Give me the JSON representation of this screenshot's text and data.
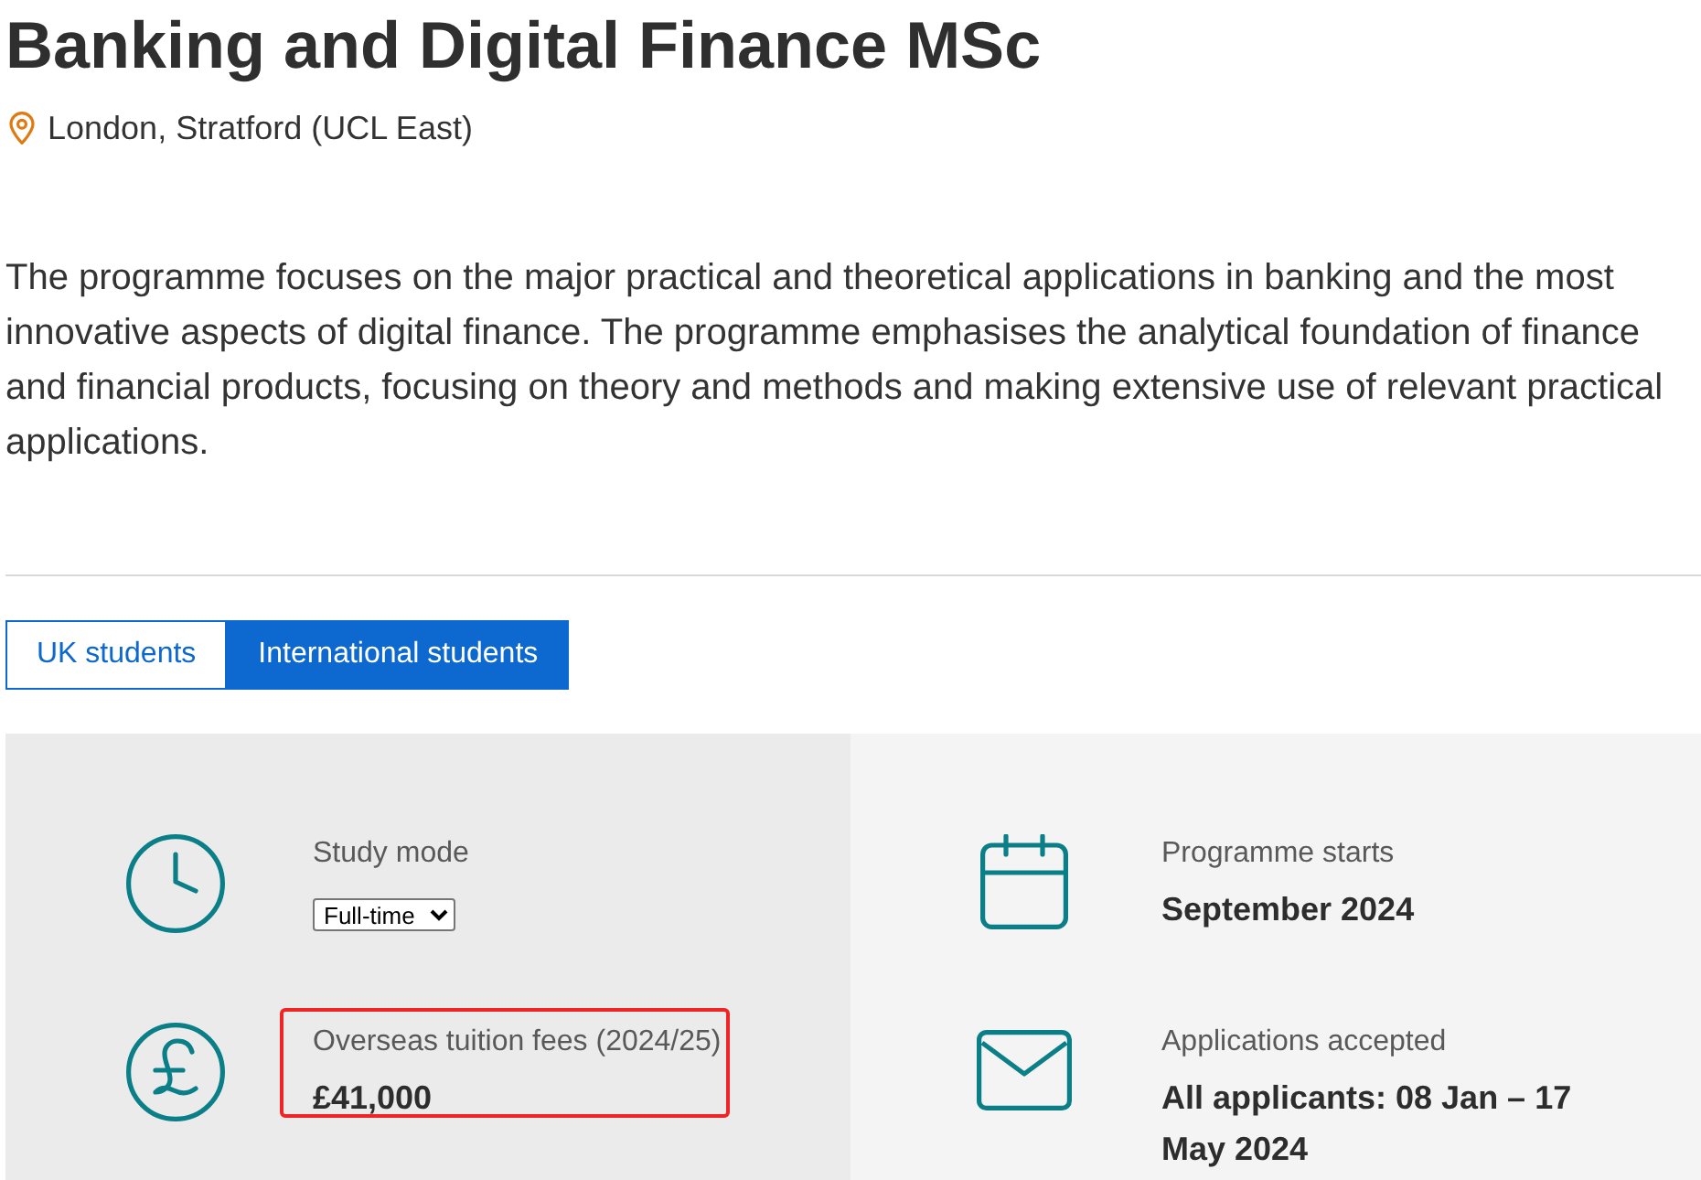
{
  "page": {
    "title": "Banking and Digital Finance MSc",
    "location": "London, Stratford (UCL East)",
    "description": "The programme focuses on the major practical and theoretical applications in banking and the most innovative aspects of digital finance. The programme emphasises the analytical foundation of finance and financial products, focusing on theory and methods and making extensive use of relevant practical applications."
  },
  "tabs": [
    {
      "label": "UK students",
      "selected": false
    },
    {
      "label": "International students",
      "selected": true
    }
  ],
  "key_facts": {
    "columns": [
      {
        "items": [
          {
            "kind": "mode",
            "label": "Study mode",
            "value": "Full-time",
            "highlighted": false
          },
          {
            "kind": "fee",
            "label": "Overseas tuition fees (2024/25)",
            "value": "£41,000",
            "highlighted": true
          }
        ]
      },
      {
        "items": [
          {
            "kind": "start",
            "label": "Programme starts",
            "value": "September 2024",
            "highlighted": false
          },
          {
            "kind": "applications",
            "label": "Applications accepted",
            "value": "All applicants: 08 Jan – 17 May 2024",
            "highlighted": false
          }
        ]
      }
    ]
  }
}
